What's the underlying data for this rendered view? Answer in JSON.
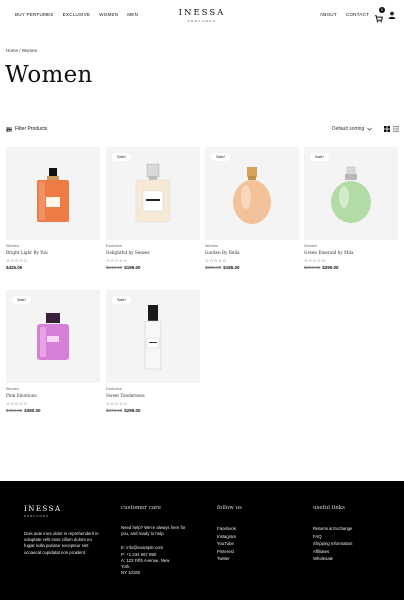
{
  "header": {
    "nav_left": [
      "BUY PERFUMES",
      "EXCLUSIVE",
      "WOMEN",
      "MEN"
    ],
    "logo": "INESSA",
    "logo_sub": "PERFUMES",
    "nav_right": [
      "ABOUT",
      "CONTACT"
    ],
    "cart_count": "0"
  },
  "breadcrumb": "Home / Women",
  "title": "Women",
  "toolbar": {
    "filter_label": "Filter Products",
    "sort_label": "Default sorting"
  },
  "products": [
    {
      "category": "Women",
      "name": "Bright Light By You",
      "sale": "",
      "old_price": "",
      "price": "$425.00",
      "stars": "☆☆☆☆☆",
      "bottle": "#ee7a45"
    },
    {
      "category": "Exclusive",
      "name": "Delightful by Senses",
      "sale": "Sale!",
      "old_price": "$215.00",
      "price": "$199.00",
      "stars": "☆☆☆☆☆",
      "bottle": "#f6ead7"
    },
    {
      "category": "Women",
      "name": "Garden By Bella",
      "sale": "Sale!",
      "old_price": "$225.00",
      "price": "$185.00",
      "stars": "☆☆☆☆☆",
      "bottle": "#f4c29a"
    },
    {
      "category": "Women",
      "name": "Green Emerald by Mila",
      "sale": "Sale!",
      "old_price": "$350.00",
      "price": "$290.00",
      "stars": "☆☆☆☆☆",
      "bottle": "#b3dba6"
    },
    {
      "category": "Women",
      "name": "Pink Emotions",
      "sale": "Sale!",
      "old_price": "$450.00",
      "price": "$390.00",
      "stars": "☆☆☆☆☆",
      "bottle": "#d77fd6"
    },
    {
      "category": "Exclusive",
      "name": "Sweet Tenderness",
      "sale": "Sale!",
      "old_price": "$375.00",
      "price": "$299.00",
      "stars": "☆☆☆☆☆",
      "bottle": "#f7f7f7"
    }
  ],
  "footer": {
    "logo": "INESSA",
    "logo_sub": "PERFUMES",
    "about": "Duis aute irure dolor in reprehenderit in voluptate velit esse cillum dolore eu fugiat nulla pariatur excepteur sint occaecat cupidatat non proident.",
    "care_heading": "customer care",
    "care_text": "Need help? We're always here for you, and ready to help.",
    "email": "E: info@example.com",
    "phone": "P: +1 234 567 890",
    "address_1": "A: 123 Fifth Avenue, New York,",
    "address_2": "NY 10160",
    "follow_heading": "follow us",
    "social": [
      "Facebook",
      "Instagram",
      "YouTube",
      "Pinterest",
      "Twitter"
    ],
    "links_heading": "useful links",
    "links": [
      "Returns & Exchange",
      "FAQ",
      "Shipping Information",
      "Affiliates",
      "Wholesale"
    ]
  }
}
